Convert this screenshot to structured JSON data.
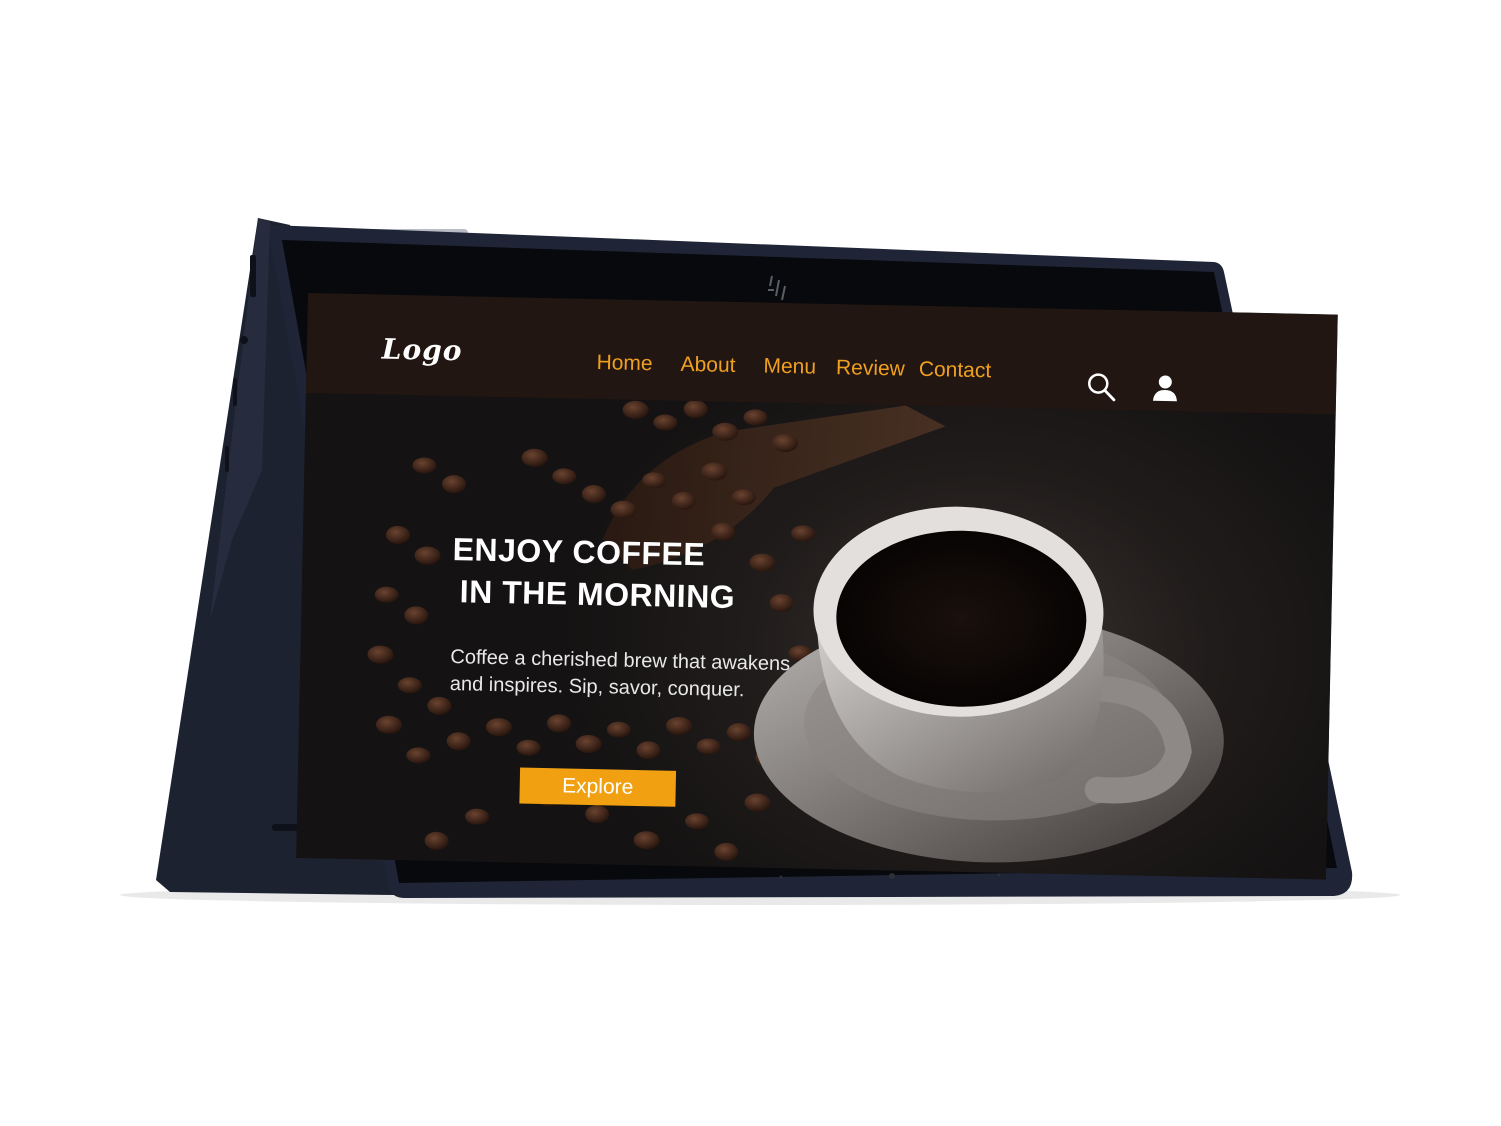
{
  "site": {
    "logo_text": "Logo",
    "nav": [
      {
        "label": "Home"
      },
      {
        "label": "About"
      },
      {
        "label": "Menu"
      },
      {
        "label": "Review"
      },
      {
        "label": "Contact"
      }
    ],
    "icons": {
      "search": "search-icon",
      "account": "user-icon"
    }
  },
  "hero": {
    "title_line1": "ENJOY COFFEE",
    "title_line2": "IN THE MORNING",
    "description": "Coffee a cherished brew that awakens and inspires. Sip, savor, conquer.",
    "button_label": "Explore"
  },
  "colors": {
    "accent": "#f0a020",
    "header_bg": "#221612",
    "device_body": "#1e2434",
    "screen_bg": "#141212"
  }
}
